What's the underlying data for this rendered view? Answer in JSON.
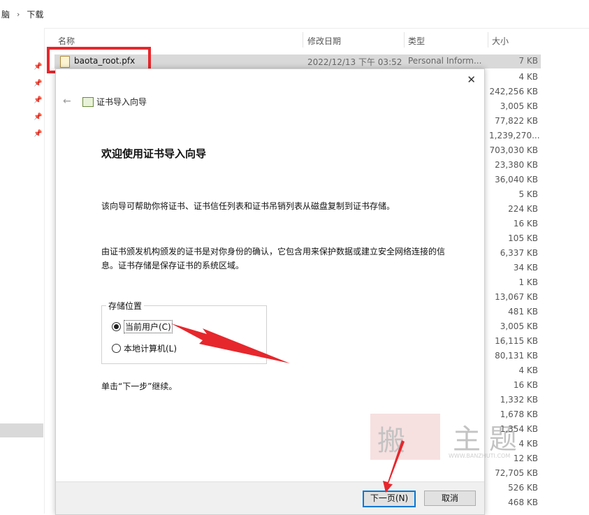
{
  "breadcrumb": {
    "part1": "脑",
    "part2": "下载",
    "sep": "›"
  },
  "columns": {
    "name": "名称",
    "date": "修改日期",
    "type": "类型",
    "size": "大小"
  },
  "file": {
    "name": "baota_root.pfx",
    "date": "2022/12/13 下午 03:52",
    "type": "Personal Inform...",
    "size": "7 KB"
  },
  "sizes": [
    "4 KB",
    "242,256 KB",
    "3,005 KB",
    "77,822 KB",
    "1,239,270...",
    "703,030 KB",
    "23,380 KB",
    "36,040 KB",
    "5 KB",
    "224 KB",
    "16 KB",
    "105 KB",
    "6,337 KB",
    "34 KB",
    "1 KB",
    "13,067 KB",
    "481 KB",
    "3,005 KB",
    "16,115 KB",
    "80,131 KB",
    "4 KB",
    "16 KB",
    "1,332 KB",
    "1,678 KB",
    "1,354 KB",
    "4 KB",
    "12 KB",
    "72,705 KB",
    "526 KB",
    "468 KB"
  ],
  "dialog": {
    "close": "✕",
    "back": "←",
    "wizard_title": "证书导入向导",
    "heading": "欢迎使用证书导入向导",
    "para1": "该向导可帮助你将证书、证书信任列表和证书吊销列表从磁盘复制到证书存储。",
    "para2": "由证书颁发机构颁发的证书是对你身份的确认，它包含用来保护数据或建立安全网络连接的信息。证书存储是保存证书的系统区域。",
    "group_label": "存储位置",
    "option_current": "当前用户(C)",
    "option_local": "本地计算机(L)",
    "continue_text": "单击“下一步”继续。",
    "next": "下一页(N)",
    "cancel": "取消"
  },
  "watermark": {
    "chars": [
      "搬",
      "主",
      "题"
    ],
    "url": "WWW.BANZHUTI.COM"
  },
  "colors": {
    "highlight": "#e6272c",
    "primary_border": "#0078d7"
  }
}
